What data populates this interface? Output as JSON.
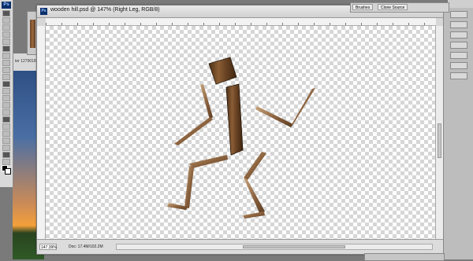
{
  "app": {
    "ps_badge": "Ps"
  },
  "document": {
    "title": "wooden hill.psd @ 147% (Right Leg, RGB/8)",
    "zoom": "147.39%",
    "doc_size": "Doc: 17.4M/102.2M",
    "background_doc_label": "ter 1279018"
  },
  "panels": {
    "tabs": [
      "Brushes",
      "Clone Source"
    ]
  },
  "colors": {
    "wood_dark": "#5a3920",
    "wood_mid": "#8b5e35",
    "wood_light": "#b8916a",
    "checker": "#d6d6d6"
  },
  "icons": {
    "tools": [
      "move-tool-icon",
      "marquee-tool-icon",
      "lasso-tool-icon",
      "quick-select-icon",
      "crop-tool-icon",
      "eyedropper-icon",
      "healing-brush-icon",
      "brush-tool-icon",
      "clone-stamp-icon",
      "history-brush-icon",
      "eraser-icon",
      "gradient-icon",
      "blur-icon",
      "dodge-icon",
      "pen-tool-icon",
      "type-tool-icon",
      "path-select-icon",
      "shape-tool-icon",
      "3d-rotate-icon",
      "3d-orbit-icon",
      "hand-tool-icon",
      "zoom-tool-icon"
    ]
  }
}
